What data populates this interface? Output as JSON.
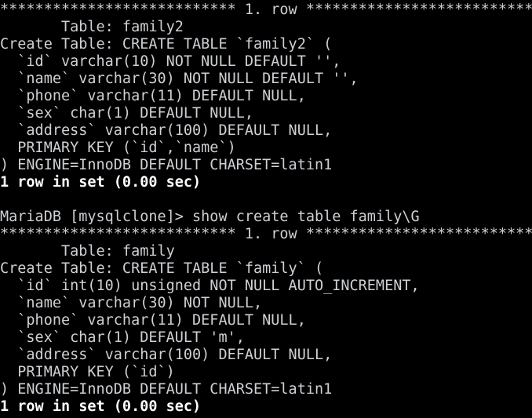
{
  "terminal": {
    "app": "MariaDB client",
    "background_color": "#000000",
    "text_color": "#cdd0d4",
    "bold_text_color": "#ffffff",
    "prompt": "MariaDB [mysqlclone]> ",
    "database": "mysqlclone",
    "columns": 62,
    "rows": 24,
    "lines": [
      {
        "text": "*************************** 1. row ***************************",
        "style": "normal",
        "name": "row-separator-banner"
      },
      {
        "text": "       Table: family2",
        "style": "normal",
        "name": "field-table-name"
      },
      {
        "text": "Create Table: CREATE TABLE `family2` (",
        "style": "normal",
        "name": "field-create-table"
      },
      {
        "text": "  `id` varchar(10) NOT NULL DEFAULT '',",
        "style": "normal",
        "name": "column-def-id"
      },
      {
        "text": "  `name` varchar(30) NOT NULL DEFAULT '',",
        "style": "normal",
        "name": "column-def-name"
      },
      {
        "text": "  `phone` varchar(11) DEFAULT NULL,",
        "style": "normal",
        "name": "column-def-phone"
      },
      {
        "text": "  `sex` char(1) DEFAULT NULL,",
        "style": "normal",
        "name": "column-def-sex"
      },
      {
        "text": "  `address` varchar(100) DEFAULT NULL,",
        "style": "normal",
        "name": "column-def-address"
      },
      {
        "text": "  PRIMARY KEY (`id`,`name`)",
        "style": "normal",
        "name": "primary-key-def"
      },
      {
        "text": ") ENGINE=InnoDB DEFAULT CHARSET=latin1",
        "style": "normal",
        "name": "table-options"
      },
      {
        "text": "1 row in set (0.00 sec)",
        "style": "bold",
        "name": "result-status"
      },
      {
        "text": "",
        "style": "blank",
        "name": "blank-line"
      },
      {
        "text": "MariaDB [mysqlclone]> show create table family\\G",
        "style": "normal",
        "name": "prompt-line"
      },
      {
        "text": "*************************** 1. row ***************************",
        "style": "normal",
        "name": "row-separator-banner"
      },
      {
        "text": "       Table: family",
        "style": "normal",
        "name": "field-table-name"
      },
      {
        "text": "Create Table: CREATE TABLE `family` (",
        "style": "normal",
        "name": "field-create-table"
      },
      {
        "text": "  `id` int(10) unsigned NOT NULL AUTO_INCREMENT,",
        "style": "normal",
        "name": "column-def-id"
      },
      {
        "text": "  `name` varchar(30) NOT NULL,",
        "style": "normal",
        "name": "column-def-name"
      },
      {
        "text": "  `phone` varchar(11) DEFAULT NULL,",
        "style": "normal",
        "name": "column-def-phone"
      },
      {
        "text": "  `sex` char(1) DEFAULT 'm',",
        "style": "normal",
        "name": "column-def-sex"
      },
      {
        "text": "  `address` varchar(100) DEFAULT NULL,",
        "style": "normal",
        "name": "column-def-address"
      },
      {
        "text": "  PRIMARY KEY (`id`)",
        "style": "normal",
        "name": "primary-key-def"
      },
      {
        "text": ") ENGINE=InnoDB DEFAULT CHARSET=latin1",
        "style": "normal",
        "name": "table-options"
      },
      {
        "text": "1 row in set (0.00 sec)",
        "style": "bold",
        "name": "result-status"
      }
    ]
  }
}
